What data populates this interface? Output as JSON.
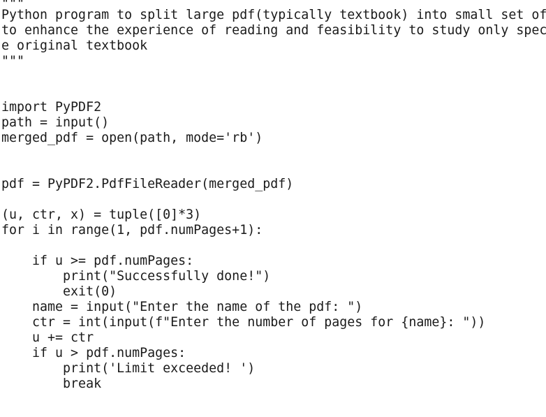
{
  "code": {
    "lines": [
      "\"\"\"",
      "Python program to split large pdf(typically textbook) into small set of",
      "to enhance the experience of reading and feasibility to study only spec",
      "e original textbook",
      "\"\"\"",
      "",
      "",
      "import PyPDF2",
      "path = input()",
      "merged_pdf = open(path, mode='rb')",
      "",
      "",
      "pdf = PyPDF2.PdfFileReader(merged_pdf)",
      "",
      "(u, ctr, x) = tuple([0]*3)",
      "for i in range(1, pdf.numPages+1):",
      "",
      "    if u >= pdf.numPages:",
      "        print(\"Successfully done!\")",
      "        exit(0)",
      "    name = input(\"Enter the name of the pdf: \")",
      "    ctr = int(input(f\"Enter the number of pages for {name}: \"))",
      "    u += ctr",
      "    if u > pdf.numPages:",
      "        print('Limit exceeded! ')",
      "        break"
    ]
  }
}
